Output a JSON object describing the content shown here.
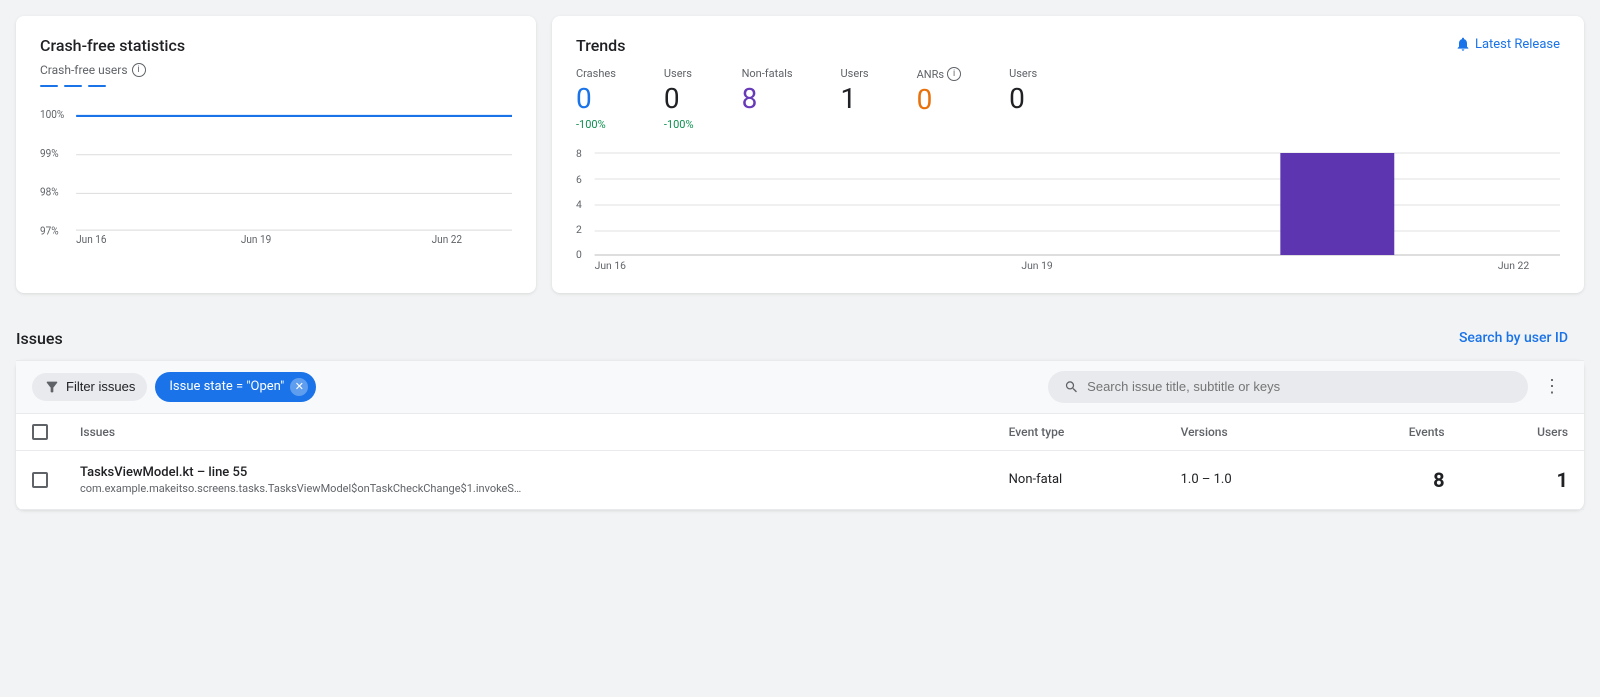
{
  "crashFree": {
    "cardTitle": "Crash-free statistics",
    "sectionLabel": "Crash-free users",
    "chartYLabels": [
      "100%",
      "99%",
      "98%",
      "97%"
    ],
    "chartXLabels": [
      "Jun 16",
      "Jun 19",
      "Jun 22"
    ],
    "chartLineValue": 100
  },
  "trends": {
    "cardTitle": "Trends",
    "latestReleaseLabel": "Latest Release",
    "stats": [
      {
        "header": "Crashes",
        "value": "0",
        "colorClass": "blue",
        "change": "-100%",
        "changeClass": "green"
      },
      {
        "header": "Users",
        "value": "0",
        "colorClass": "default",
        "change": "-100%",
        "changeClass": "green"
      },
      {
        "header": "Non-fatals",
        "value": "8",
        "colorClass": "purple",
        "change": "",
        "changeClass": ""
      },
      {
        "header": "Users",
        "value": "1",
        "colorClass": "default",
        "change": "",
        "changeClass": ""
      },
      {
        "header": "ANRs",
        "value": "0",
        "colorClass": "orange",
        "change": "",
        "changeClass": ""
      },
      {
        "header": "Users",
        "value": "0",
        "colorClass": "default",
        "change": "",
        "changeClass": ""
      }
    ],
    "chartYLabels": [
      "8",
      "6",
      "4",
      "2",
      "0"
    ],
    "chartXLabels": [
      "Jun 16",
      "Jun 19",
      "Jun 22"
    ]
  },
  "issues": {
    "sectionTitle": "Issues",
    "searchByUserLabel": "Search by user ID",
    "filterBtn": "Filter issues",
    "chip": "Issue state = \"Open\"",
    "searchPlaceholder": "Search issue title, subtitle or keys",
    "columns": {
      "issues": "Issues",
      "eventType": "Event type",
      "versions": "Versions",
      "events": "Events",
      "users": "Users"
    },
    "rows": [
      {
        "title": "TasksViewModel.kt – line 55",
        "subtitle": "com.example.makeitso.screens.tasks.TasksViewModel$onTaskCheckChange$1.invokeS…",
        "eventType": "Non-fatal",
        "versions": "1.0 – 1.0",
        "events": "8",
        "users": "1"
      }
    ]
  }
}
